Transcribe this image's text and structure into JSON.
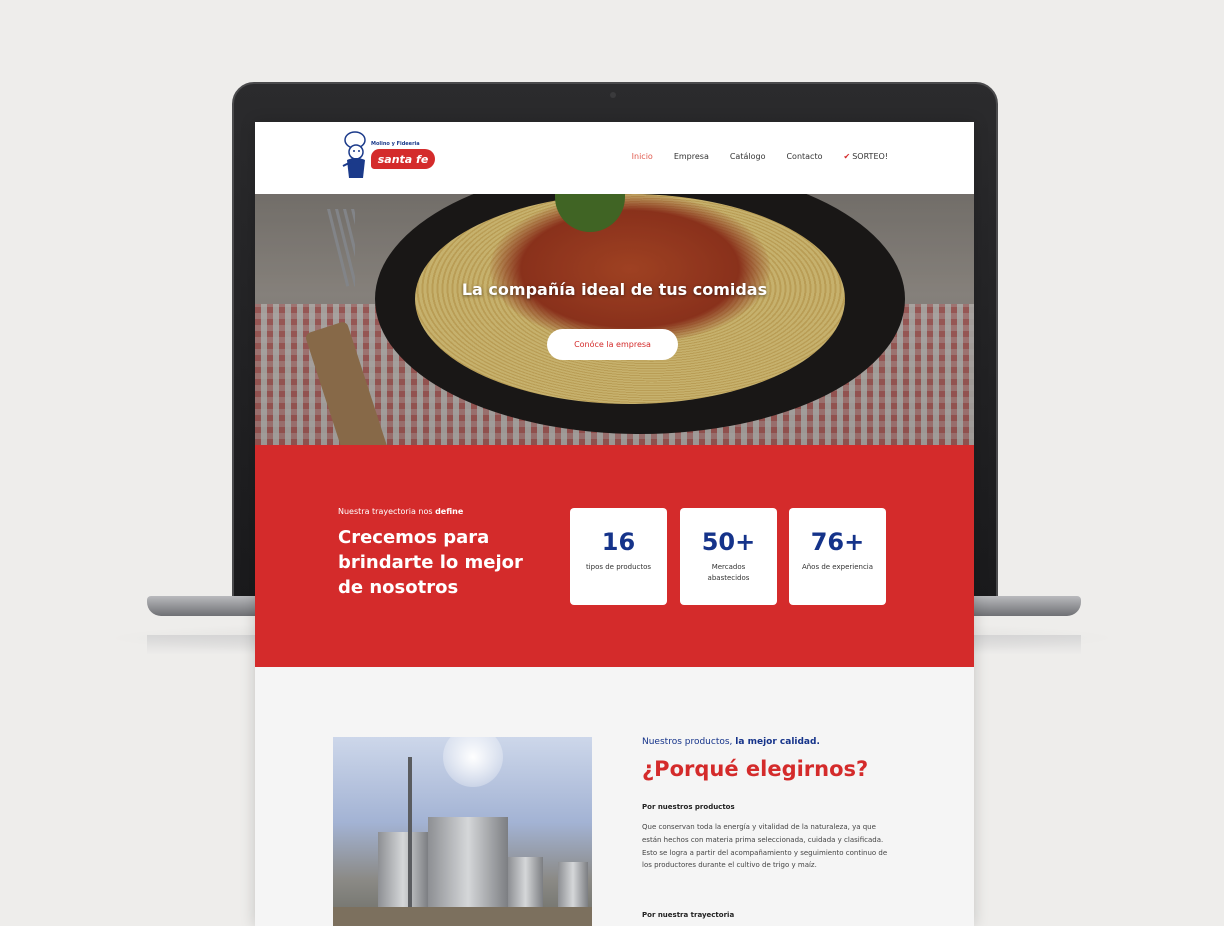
{
  "logo": {
    "tagline": "Molino y Fideeria",
    "brand": "santa fe"
  },
  "nav": {
    "items": [
      {
        "label": "Inicio",
        "active": true
      },
      {
        "label": "Empresa"
      },
      {
        "label": "Catálogo"
      },
      {
        "label": "Contacto"
      },
      {
        "label": "SORTEO!"
      }
    ]
  },
  "hero": {
    "title": "La compañía ideal de tus comidas",
    "button_label": "Conóce la empresa"
  },
  "stats": {
    "eyebrow_prefix": "Nuestra trayectoria nos",
    "eyebrow_bold": "define",
    "heading": "Crecemos para brindarte lo mejor de nosotros",
    "cards": [
      {
        "number": "16",
        "label": "tipos de productos"
      },
      {
        "number": "50+",
        "label": "Mercados abastecidos"
      },
      {
        "number": "76+",
        "label": "Años de experiencia"
      }
    ]
  },
  "about": {
    "eyebrow_prefix": "Nuestros productos,",
    "eyebrow_bold": "la mejor calidad.",
    "title": "¿Porqué elegirnos?",
    "subheading1": "Por nuestros productos",
    "paragraph": "Que conservan toda la energía y vitalidad de la naturaleza, ya que están hechos con materia prima seleccionada, cuidada y clasificada. Esto se logra a partir del acompañamiento y seguimiento continuo de los productores durante el cultivo de trigo y maíz.",
    "subheading2": "Por nuestra trayectoria"
  },
  "colors": {
    "brand_red": "#d42b2b",
    "brand_blue": "#15338a",
    "nav_active": "#e05a4e"
  }
}
